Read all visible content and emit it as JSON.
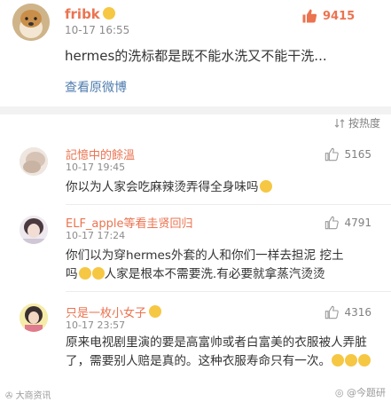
{
  "post": {
    "username": "fribk",
    "time": "10-17 16:55",
    "text": "hermes的洗标都是既不能水洗又不能干洗...",
    "view_original": "查看原微博",
    "likes": "9415"
  },
  "sort_label": "按热度",
  "comments": [
    {
      "username": "記憶中的餘溫",
      "time": "10-17 19:45",
      "likes": "5165",
      "text": "你以为人家会吃麻辣烫弄得全身味吗"
    },
    {
      "username": "ELF_apple等看圭贤回归",
      "time": "10-17 17:24",
      "likes": "4791",
      "text_line1": "你们以为穿hermes外套的人和你们一样去担泥 挖土",
      "text_line2_a": "吗",
      "text_line2_b": "人家是根本不需要洗.有必要就拿蒸汽烫烫"
    },
    {
      "username": "只是一枚小女子",
      "time": "10-17 23:57",
      "likes": "4316",
      "text": "原来电视剧里演的要是高富帅或者白富美的衣服被人弄脏了，需要别人赔是真的。这种衣服寿命只有一次。"
    }
  ],
  "watermark_left": "大商资讯",
  "watermark_right": "今题研"
}
